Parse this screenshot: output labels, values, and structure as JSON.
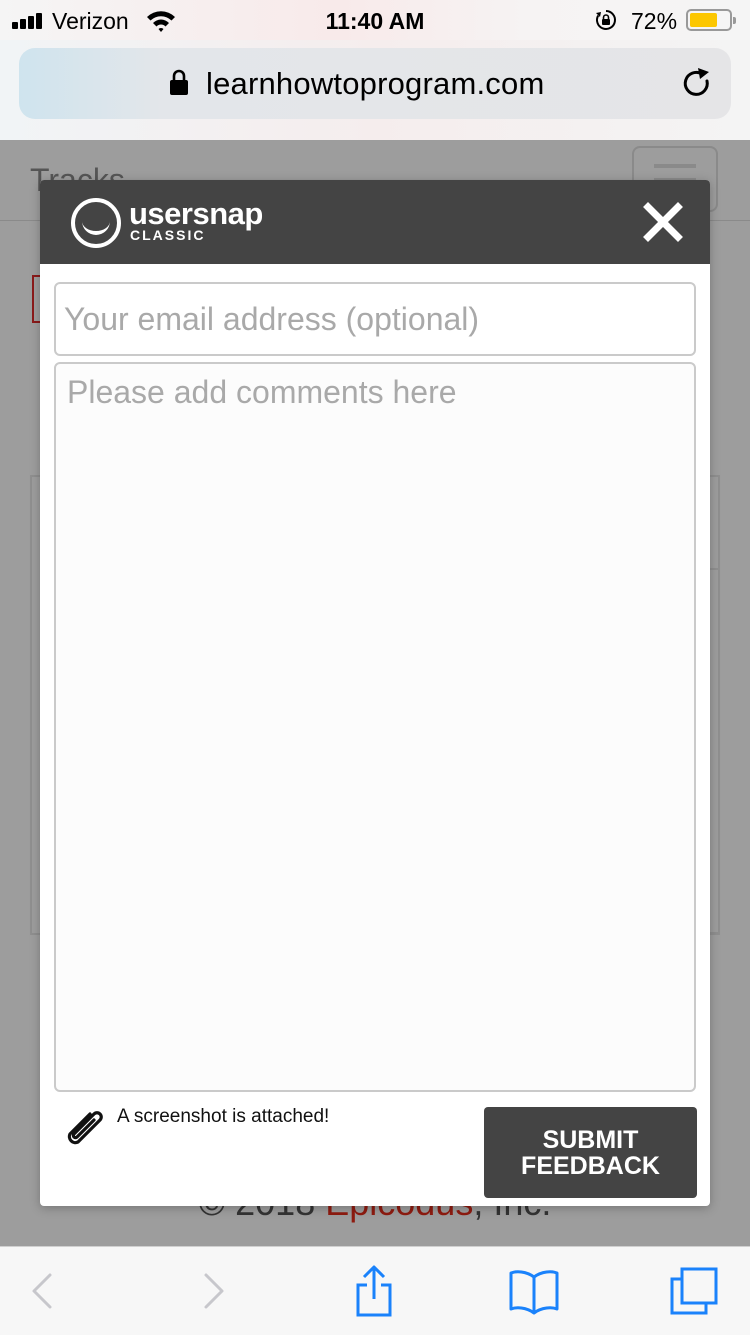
{
  "status_bar": {
    "carrier": "Verizon",
    "time": "11:40 AM",
    "battery_percent": "72%",
    "battery_level": 0.72,
    "battery_color": "#fcc700",
    "icons": [
      "signal-icon",
      "wifi-icon",
      "rotation-lock-icon",
      "battery-icon"
    ]
  },
  "browser": {
    "url": "learnhowtoprogram.com",
    "secure": true,
    "icons": [
      "lock-icon",
      "reload-icon"
    ]
  },
  "background_page": {
    "brand": "Tracks",
    "footer": {
      "prefix": "© 2018 ",
      "company": "Epicodus",
      "suffix": ", Inc."
    },
    "accent_color": "#8e1b10"
  },
  "feedback_modal": {
    "logo": {
      "name": "usersnap",
      "edition": "CLASSIC"
    },
    "email_placeholder": "Your email address (optional)",
    "email_value": "",
    "comments_placeholder": "Please add comments here",
    "comments_value": "",
    "attachment_note": "A screenshot is attached!",
    "submit_label": "SUBMIT\nFEEDBACK",
    "header_color": "#444444"
  },
  "toolbar": {
    "items": [
      "back-icon",
      "forward-icon",
      "share-icon",
      "bookmarks-icon",
      "tabs-icon"
    ],
    "accent_color": "#1a82fb"
  }
}
